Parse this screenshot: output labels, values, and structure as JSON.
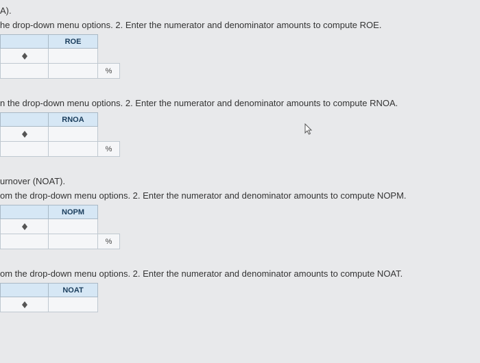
{
  "sections": [
    {
      "pre_lines": [
        "A)."
      ],
      "instruction": "he drop-down menu options. 2. Enter the numerator and denominator amounts to compute ROE.",
      "header_label": "ROE",
      "unit": "%"
    },
    {
      "pre_lines": [],
      "instruction": "n the drop-down menu options. 2. Enter the numerator and denominator amounts to compute RNOA.",
      "header_label": "RNOA",
      "unit": "%"
    },
    {
      "pre_lines": [
        "urnover (NOAT)."
      ],
      "instruction": "om the drop-down menu options. 2. Enter the numerator and denominator amounts to compute NOPM.",
      "header_label": "NOPM",
      "unit": "%"
    },
    {
      "pre_lines": [],
      "instruction": "om the drop-down menu options. 2. Enter the numerator and denominator amounts to compute NOAT.",
      "header_label": "NOAT",
      "unit": ""
    }
  ]
}
